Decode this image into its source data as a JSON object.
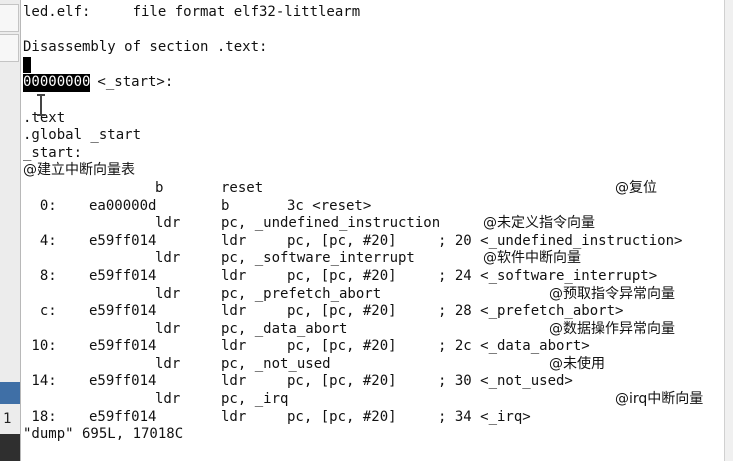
{
  "terminal": {
    "header": "led.elf:     file format elf32-littlearm",
    "section_line": "Disassembly of section .text:",
    "start_addr": "00000000",
    "start_label": " <_start>:",
    "directive_text": ".text",
    "directive_global": ".global _start",
    "label_start": "_start:",
    "comment_table": "@建立中断向量表",
    "source_b": "b",
    "source_reset": "reset",
    "comment_reset": "@复位",
    "lines": [
      {
        "addr": "0:",
        "hex": "ea00000d",
        "op": "b",
        "args": "3c <reset>"
      },
      {
        "src_op": "ldr",
        "src_args": "pc, _undefined_instruction",
        "comment": "@未定义指令向量"
      },
      {
        "addr": "4:",
        "hex": "e59ff014",
        "op": "ldr",
        "args": "pc, [pc, #20]",
        "note": "; 20 <_undefined_instruction>"
      },
      {
        "src_op": "ldr",
        "src_args": "pc, _software_interrupt",
        "comment": "@软件中断向量"
      },
      {
        "addr": "8:",
        "hex": "e59ff014",
        "op": "ldr",
        "args": "pc, [pc, #20]",
        "note": "; 24 <_software_interrupt>"
      },
      {
        "src_op": "ldr",
        "src_args": "pc, _prefetch_abort",
        "comment": "@预取指令异常向量"
      },
      {
        "addr": "c:",
        "hex": "e59ff014",
        "op": "ldr",
        "args": "pc, [pc, #20]",
        "note": "; 28 <_prefetch_abort>"
      },
      {
        "src_op": "ldr",
        "src_args": "pc, _data_abort",
        "comment": "@数据操作异常向量"
      },
      {
        "addr": "10:",
        "hex": "e59ff014",
        "op": "ldr",
        "args": "pc, [pc, #20]",
        "note": "; 2c <_data_abort>"
      },
      {
        "src_op": "ldr",
        "src_args": "pc, _not_used",
        "comment": "@未使用"
      },
      {
        "addr": "14:",
        "hex": "e59ff014",
        "op": "ldr",
        "args": "pc, [pc, #20]",
        "note": "; 30 <_not_used>"
      },
      {
        "src_op": "ldr",
        "src_args": "pc, _irq",
        "comment": "@irq中断向量"
      },
      {
        "addr": "18:",
        "hex": "e59ff014",
        "op": "ldr",
        "args": "pc, [pc, #20]",
        "note": "; 34 <_irq>"
      }
    ],
    "status_line": "\"dump\" 695L, 17018C"
  },
  "left_window": {
    "line_number": "1"
  },
  "colors": {
    "selection_bg": "#000000",
    "text": "#111111",
    "background": "#ffffff"
  }
}
